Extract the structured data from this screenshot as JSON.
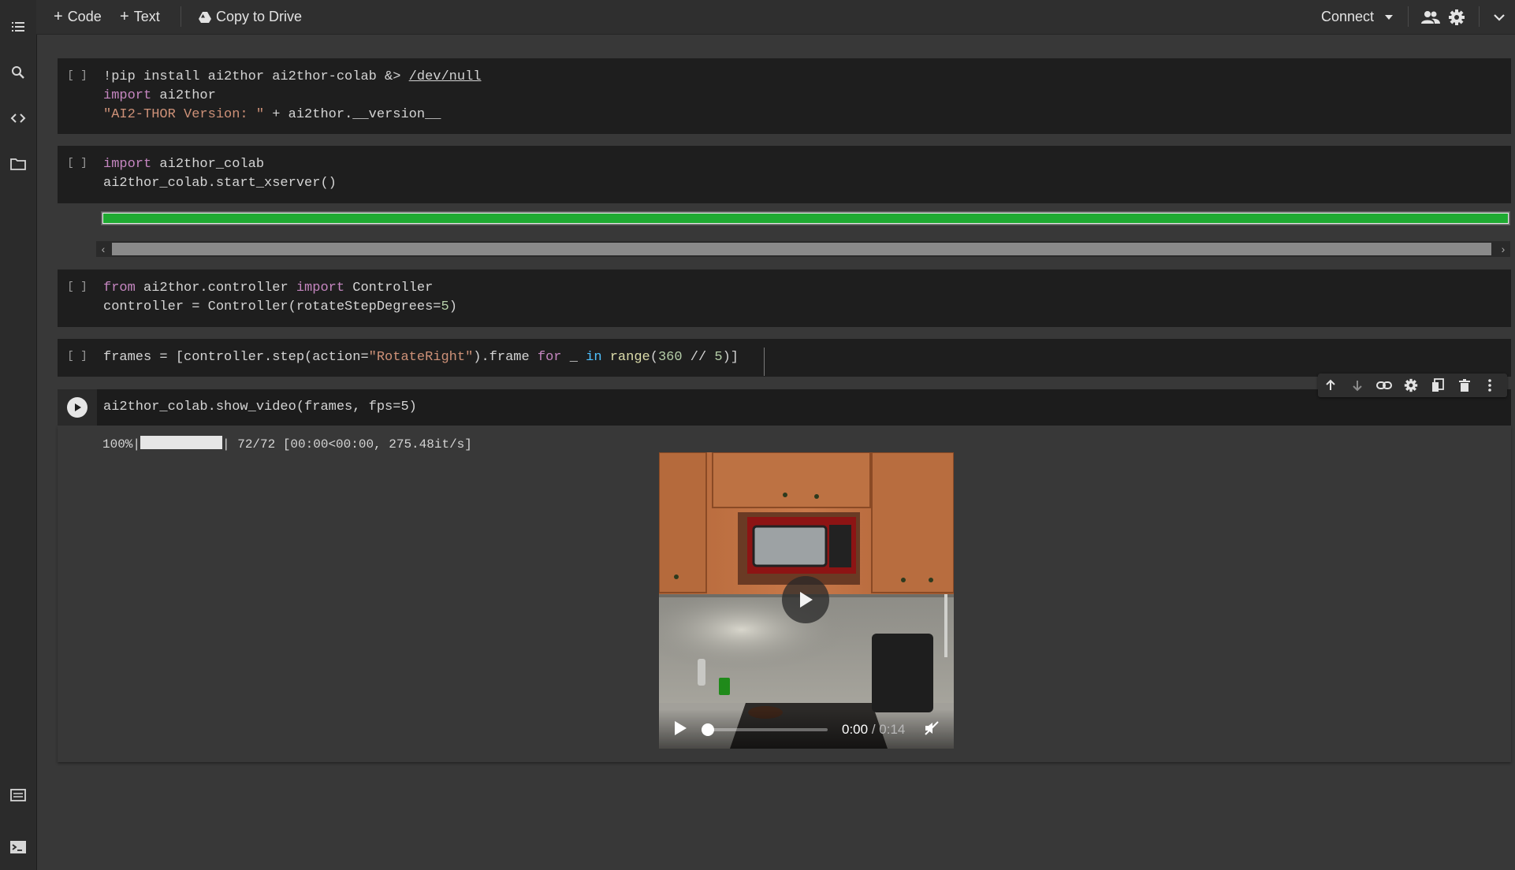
{
  "toolbar": {
    "add_code_label": "Code",
    "add_text_label": "Text",
    "copy_to_drive_label": "Copy to Drive",
    "connect_label": "Connect"
  },
  "sidebar": {
    "items": [
      "table-of-contents",
      "search",
      "code-snippets",
      "files"
    ],
    "bottom_items": [
      "command-palette",
      "terminal"
    ]
  },
  "cells": [
    {
      "prompt": "[ ]",
      "lines": [
        "!pip install ai2thor ai2thor-colab &> /dev/null",
        "import ai2thor",
        "\"AI2-THOR Version: \" + ai2thor.__version__"
      ]
    },
    {
      "prompt": "[ ]",
      "lines": [
        "import ai2thor_colab",
        "ai2thor_colab.start_xserver()"
      ],
      "output_progress": 1.0
    },
    {
      "prompt": "[ ]",
      "lines": [
        "from ai2thor.controller import Controller",
        "controller = Controller(rotateStepDegrees=5)"
      ]
    },
    {
      "prompt": "[ ]",
      "lines": [
        "frames = [controller.step(action=\"RotateRight\").frame for _ in range(360 // 5)]"
      ]
    },
    {
      "lines": [
        "ai2thor_colab.show_video(frames, fps=5)"
      ],
      "output": {
        "progress_prefix": "100%|",
        "progress_suffix": "| 72/72 [00:00<00:00, 275.48it/s]",
        "progress": 1.0,
        "video": {
          "current_time": "0:00",
          "separator": " / ",
          "duration": "0:14",
          "position": 0.0
        }
      }
    }
  ],
  "colors": {
    "background": "#383838",
    "cell_background": "#1e1e1e",
    "progress_green": "#1faa32",
    "keyword": "#c586c0",
    "string": "#ce9178"
  }
}
